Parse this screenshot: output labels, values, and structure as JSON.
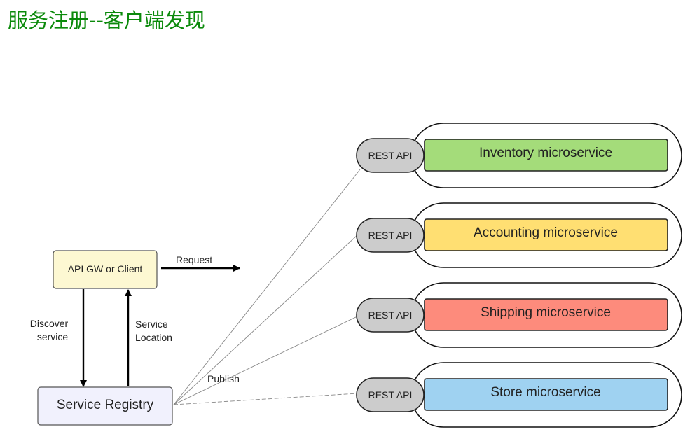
{
  "title": "服务注册--客户端发现",
  "client_box": {
    "label": "API GW or Client",
    "fill": "#fdf8d2"
  },
  "registry_box": {
    "label": "Service Registry",
    "fill": "#f1f1fd"
  },
  "edges": {
    "request": "Request",
    "discover_line1": "Discover",
    "discover_line2": "service",
    "location_line1": "Service",
    "location_line2": "Location",
    "publish": "Publish"
  },
  "rest_api_label": "REST API",
  "rest_api_fill": "#cccccc",
  "services": [
    {
      "name": "Inventory microservice",
      "fill": "#a4dc7a"
    },
    {
      "name": "Accounting microservice",
      "fill": "#ffdf72"
    },
    {
      "name": "Shipping microservice",
      "fill": "#fd8b7c"
    },
    {
      "name": "Store microservice",
      "fill": "#9fd2f1"
    }
  ]
}
